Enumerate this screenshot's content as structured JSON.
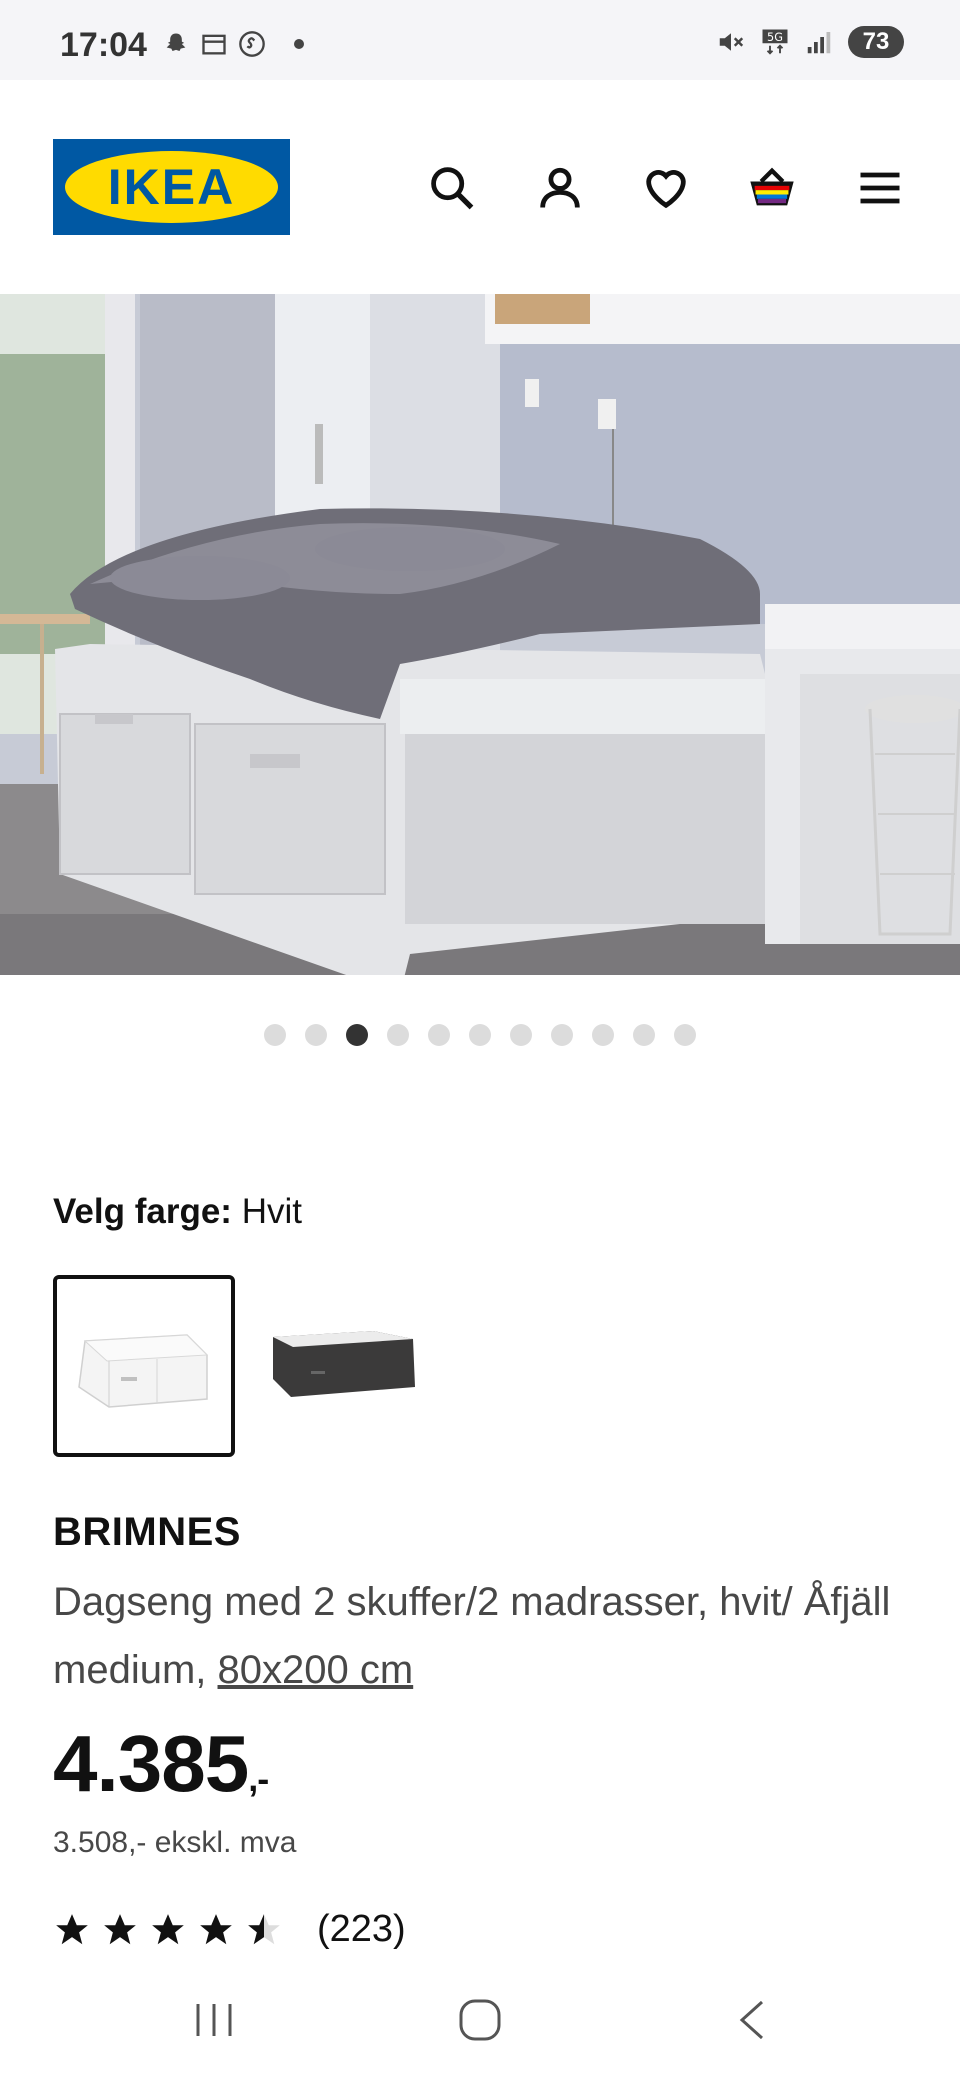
{
  "status_bar": {
    "time": "17:04",
    "battery": "73"
  },
  "header": {
    "logo_text": "IKEA",
    "icons": [
      "search-icon",
      "account-icon",
      "heart-icon",
      "cart-icon",
      "menu-icon"
    ]
  },
  "gallery": {
    "total": 11,
    "active_index": 2
  },
  "color": {
    "label": "Velg farge:",
    "value": "Hvit",
    "options": [
      "Hvit",
      "Svart-brun"
    ]
  },
  "product": {
    "name": "BRIMNES",
    "description": "Dagseng med 2 skuffer/2 madrasser, hvit/ Åfjäll medium,",
    "size_link": "80x200 cm",
    "price": "4.385",
    "price_suffix": ",-",
    "price_ex_vat": "3.508,- ekskl. mva",
    "rating": 4.5,
    "review_count": "(223)"
  },
  "colors": {
    "ikea_blue": "#0058a3",
    "ikea_yellow": "#ffdb00"
  }
}
